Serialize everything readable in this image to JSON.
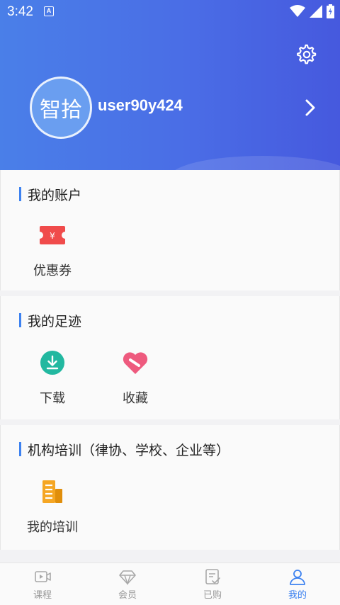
{
  "status_bar": {
    "time": "3:42",
    "notification_badge": "A"
  },
  "profile": {
    "avatar_text": "智拾",
    "username": "user90y424"
  },
  "sections": [
    {
      "title": "我的账户",
      "items": [
        {
          "label": "优惠券",
          "icon": "coupon-icon"
        }
      ]
    },
    {
      "title": "我的足迹",
      "items": [
        {
          "label": "下载",
          "icon": "download-icon"
        },
        {
          "label": "收藏",
          "icon": "favorite-heart-icon"
        }
      ]
    },
    {
      "title": "机构培训（律协、学校、企业等）",
      "items": [
        {
          "label": "我的培训",
          "icon": "training-building-icon"
        }
      ]
    }
  ],
  "bottom_nav": [
    {
      "label": "课程",
      "icon": "course-video-icon",
      "active": false
    },
    {
      "label": "会员",
      "icon": "member-diamond-icon",
      "active": false
    },
    {
      "label": "已购",
      "icon": "purchased-list-icon",
      "active": false
    },
    {
      "label": "我的",
      "icon": "profile-person-icon",
      "active": true
    }
  ],
  "colors": {
    "header_start": "#4a7fe8",
    "header_end": "#4659de",
    "accent": "#3d82f0",
    "coupon_red": "#f04b4b",
    "download_teal": "#22b8a0",
    "heart_pink": "#ee5a7e",
    "training_orange": "#f5a623"
  }
}
